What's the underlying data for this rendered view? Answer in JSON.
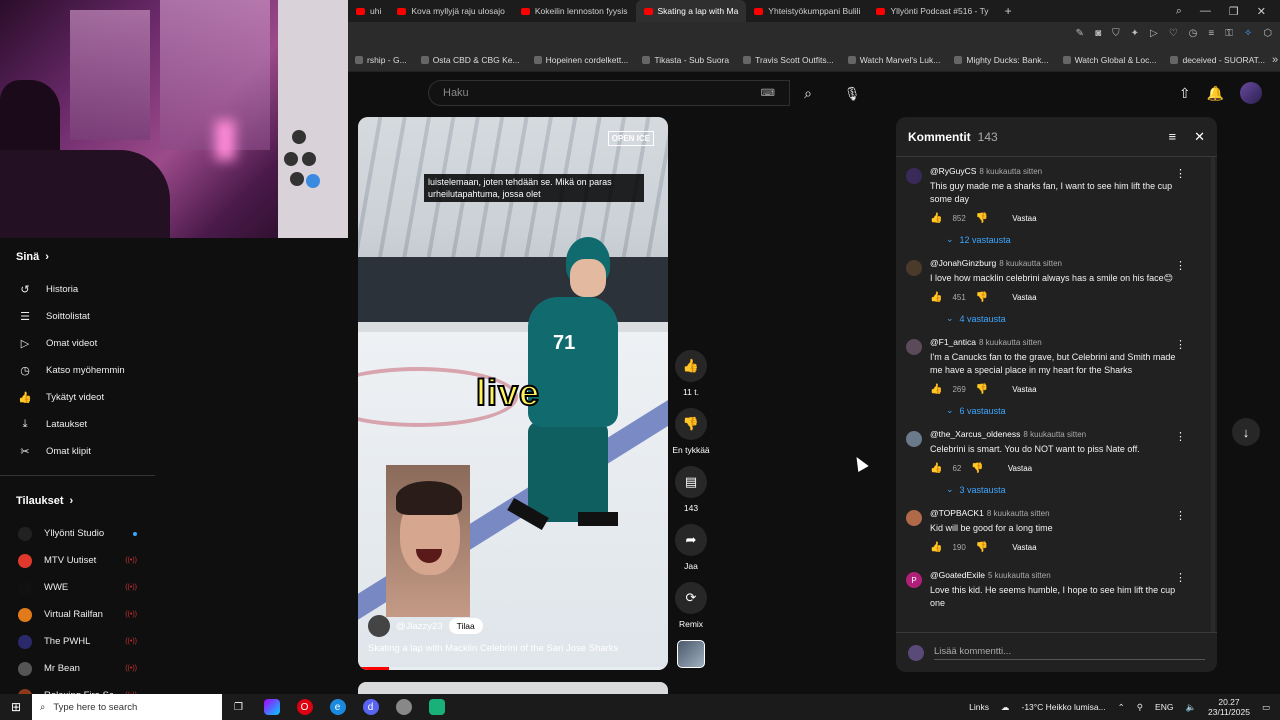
{
  "browser": {
    "tabs": [
      {
        "label": "uhi",
        "active": false
      },
      {
        "label": "Kova myllyjä raju ulosajo",
        "active": false
      },
      {
        "label": "Kokeilin lennoston fyysis",
        "active": false
      },
      {
        "label": "Skating a lap with Ma",
        "active": true
      },
      {
        "label": "Yhteistyökumppani Bulili",
        "active": false
      },
      {
        "label": "Yllyönti Podcast #516 - Ty",
        "active": false
      }
    ],
    "bookmarks": [
      "rship - G...",
      "Osta CBD & CBG Ke...",
      "Hopeinen cordelkett...",
      "Tikasta - Sub Suora",
      "Travis Scott Outfits...",
      "Watch Marvel's Luk...",
      "Mighty Ducks: Bank...",
      "Watch Global & Loc...",
      "deceived - SUORAT..."
    ]
  },
  "header": {
    "search_placeholder": "Haku"
  },
  "sidebar": {
    "you_heading": "Sinä",
    "items": [
      {
        "icon": "history-icon",
        "glyph": "↺",
        "label": "Historia"
      },
      {
        "icon": "playlist-icon",
        "glyph": "☰",
        "label": "Soittolistat"
      },
      {
        "icon": "your-videos-icon",
        "glyph": "▷",
        "label": "Omat videot"
      },
      {
        "icon": "watch-later-icon",
        "glyph": "◷",
        "label": "Katso myöhemmin"
      },
      {
        "icon": "liked-icon",
        "glyph": "👍",
        "label": "Tykätyt videot"
      },
      {
        "icon": "download-icon",
        "glyph": "⤓",
        "label": "Lataukset"
      },
      {
        "icon": "clips-icon",
        "glyph": "✂",
        "label": "Omat klipit"
      }
    ],
    "subs_heading": "Tilaukset",
    "subscriptions": [
      {
        "name": "Yllyönti Studio",
        "color": "#222222",
        "status": "dot"
      },
      {
        "name": "MTV Uutiset",
        "color": "#e0392b",
        "status": "live"
      },
      {
        "name": "WWE",
        "color": "#111111",
        "status": "live"
      },
      {
        "name": "Virtual Railfan",
        "color": "#e07a1a",
        "status": "live"
      },
      {
        "name": "The PWHL",
        "color": "#2a2a6a",
        "status": "live"
      },
      {
        "name": "Mr Bean",
        "color": "#555555",
        "status": "live"
      },
      {
        "name": "Relaxing Fire Sou...",
        "color": "#8a3a1a",
        "status": "live"
      }
    ]
  },
  "video": {
    "caption": "luistelemaan, joten tehdään se. Mikä on paras urheilutapahtuma, jossa olet",
    "brand": "OPEN ICE",
    "overlay_word": "live",
    "jersey_number": "71",
    "channel": "@Jlazzy23",
    "subscribe_label": "Tilaa",
    "title": "Skating a lap with Macklin Celebrini of the San Jose Sharks",
    "progress": 0.1
  },
  "rail": {
    "like_count": "11 t.",
    "dislike_label": "En tykkää",
    "comment_count": "143",
    "share_label": "Jaa",
    "remix_label": "Remix"
  },
  "comments": {
    "title": "Kommentit",
    "count": "143",
    "add_placeholder": "Lisää kommentti...",
    "reply_label": "Vastaa",
    "items": [
      {
        "author": "@RyGuyCS",
        "ago": "8 kuukautta sitten",
        "text": "This guy made me a sharks fan, I want to see him lift the cup some day",
        "likes": "852",
        "replies": "12 vastausta",
        "avatar_color": "#3a2a5a",
        "initial": ""
      },
      {
        "author": "@JonahGinzburg",
        "ago": "8 kuukautta sitten",
        "text": "I love how macklin celebrini always has a smile on his face😊",
        "likes": "451",
        "replies": "4 vastausta",
        "avatar_color": "#4a3a2a",
        "initial": ""
      },
      {
        "author": "@F1_antica",
        "ago": "8 kuukautta sitten",
        "text": "I'm a Canucks fan to the grave, but Celebrini and Smith made me have a special place in my heart for the Sharks",
        "likes": "269",
        "replies": "6 vastausta",
        "avatar_color": "#5a4a5a",
        "initial": ""
      },
      {
        "author": "@the_Xarcus_oldeness",
        "ago": "8 kuukautta sitten",
        "text": "Celebrini is smart. You do NOT want to piss Nate off.",
        "likes": "62",
        "replies": "3 vastausta",
        "avatar_color": "#6a7a8a",
        "initial": ""
      },
      {
        "author": "@TOPBACK1",
        "ago": "8 kuukautta sitten",
        "text": "Kid will be good for a long time",
        "likes": "190",
        "replies": "",
        "avatar_color": "#b06a4a",
        "initial": ""
      },
      {
        "author": "@GoatedExile",
        "ago": "5 kuukautta sitten",
        "text": "Love this kid. He seems humble, I hope to see him lift the cup one",
        "likes": "",
        "replies": "",
        "avatar_color": "#b0207a",
        "initial": "P"
      }
    ]
  },
  "taskbar": {
    "search_placeholder": "Type here to search",
    "links_label": "Links",
    "weather": "-13°C  Heikko lumisa...",
    "lang": "ENG",
    "time": "20.27",
    "date": "23/11/2025"
  }
}
